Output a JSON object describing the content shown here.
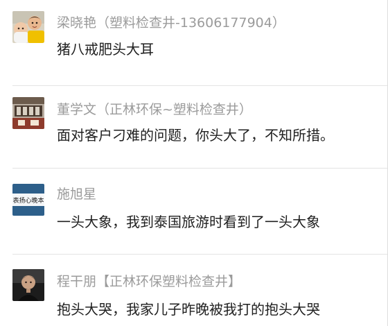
{
  "comments": [
    {
      "name": "梁晓艳（塑料检查井-13606177904）",
      "text": "猪八戒肥头大耳",
      "avatar_icon": "two-children-photo-icon"
    },
    {
      "name": "董学文（正林环保~塑料检查井）",
      "text": "面对客户刁难的问题，你头大了，不知所措。",
      "avatar_icon": "building-photo-icon"
    },
    {
      "name": "施旭星",
      "text": "一头大象，我到泰国旅游时看到了一头大象",
      "avatar_icon": "calligraphy-sign-icon",
      "avatar_text": "表扬心晚本"
    },
    {
      "name": "程干朋【正林环保塑料检查井】",
      "text": "抱头大哭，我家儿子昨晚被我打的抱头大哭",
      "avatar_icon": "man-portrait-icon"
    }
  ],
  "colors": {
    "name": "#9b9b9b",
    "text": "#1f1f1f",
    "divider": "#e3e3e3",
    "background": "#ffffff"
  }
}
